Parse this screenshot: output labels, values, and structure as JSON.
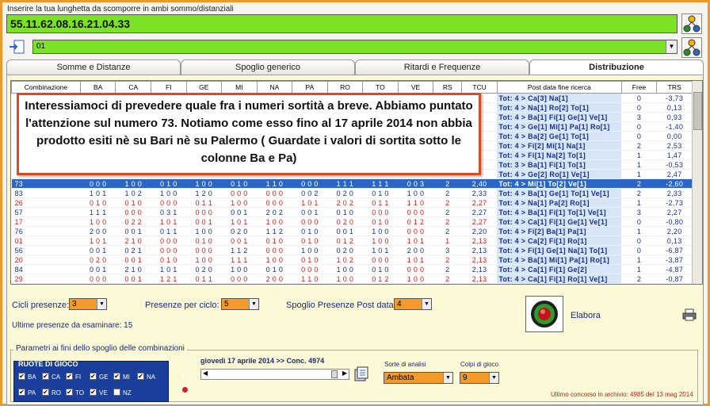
{
  "header": {
    "input_label": "Inserire la tua lunghetta da scomporre in ambi sommo/distanziali",
    "input_value": "55.11.62.08.16.21.04.33",
    "combo_value": "01"
  },
  "tabs": [
    "Somme e Distanze",
    "Spoglio generico",
    "Ritardi e Frequenze",
    "Distribuzione"
  ],
  "active_tab": "Distribuzione",
  "table": {
    "columns": [
      "Combinazione",
      "BA",
      "CA",
      "FI",
      "GE",
      "MI",
      "NA",
      "PA",
      "RO",
      "TO",
      "VE",
      "RS",
      "TCU",
      "Post data fine ricerca",
      "Free",
      "TRS"
    ],
    "rows": [
      {
        "comb": "",
        "cells": [
          "",
          "",
          "",
          "",
          "",
          "",
          "",
          "",
          "",
          "",
          "",
          ""
        ],
        "post": "Tot:  4 > Ca[3] Na[1]",
        "free": "0",
        "trs": "-3,73",
        "sel": false
      },
      {
        "comb": "",
        "cells": [
          "",
          "",
          "",
          "",
          "",
          "",
          "",
          "",
          "",
          "",
          "",
          ""
        ],
        "post": "Tot:  4 > Na[1] Ro[2] To[1]",
        "free": "0",
        "trs": "0,13",
        "sel": false
      },
      {
        "comb": "",
        "cells": [
          "",
          "",
          "",
          "",
          "",
          "",
          "",
          "",
          "",
          "",
          "",
          ""
        ],
        "post": "Tot:  4 > Ba[1] Fi[1] Ge[1] Ve[1]",
        "free": "3",
        "trs": "0,93",
        "sel": false
      },
      {
        "comb": "",
        "cells": [
          "",
          "",
          "",
          "",
          "",
          "",
          "",
          "",
          "",
          "",
          "",
          ""
        ],
        "post": "Tot:  4 > Ge[1] Mi[1] Pa[1] Ro[1]",
        "free": "0",
        "trs": "-1,40",
        "sel": false
      },
      {
        "comb": "",
        "cells": [
          "",
          "",
          "",
          "",
          "",
          "",
          "",
          "",
          "",
          "",
          "",
          ""
        ],
        "post": "Tot:  4 > Ba[2] Ge[1] To[1]",
        "free": "0",
        "trs": "0,00",
        "sel": false
      },
      {
        "comb": "",
        "cells": [
          "",
          "",
          "",
          "",
          "",
          "",
          "",
          "",
          "",
          "",
          "",
          ""
        ],
        "post": "Tot:  4 > Fi[2] Mi[1] Na[1]",
        "free": "2",
        "trs": "2,53",
        "sel": false
      },
      {
        "comb": "",
        "cells": [
          "",
          "",
          "",
          "",
          "",
          "",
          "",
          "",
          "",
          "",
          "",
          ""
        ],
        "post": "Tot:  4 > Fi[1] Na[2] To[1]",
        "free": "1",
        "trs": "1,47",
        "sel": false
      },
      {
        "comb": "",
        "cells": [
          "",
          "",
          "",
          "",
          "",
          "",
          "",
          "",
          "",
          "",
          "",
          ""
        ],
        "post": "Tot:  3 > Ba[1] Fi[1] To[1]",
        "free": "1",
        "trs": "-0,53",
        "sel": false
      },
      {
        "comb": "",
        "cells": [
          "",
          "",
          "",
          "",
          "",
          "",
          "",
          "",
          "",
          "",
          "",
          ""
        ],
        "post": "Tot:  4 > Ge[2] Ro[1] Ve[1]",
        "free": "1",
        "trs": "2,47",
        "sel": false
      },
      {
        "comb": "73",
        "cells": [
          "000",
          "100",
          "010",
          "100",
          "010",
          "110",
          "000",
          "111",
          "111",
          "003",
          "2",
          "2,40"
        ],
        "post": "Tot:  4 > Mi[1] To[2] Ve[1]",
        "free": "2",
        "trs": "-2,60",
        "sel": true
      },
      {
        "comb": "83",
        "cells": [
          "101",
          "102",
          "100",
          "120",
          "000",
          "000",
          "002",
          "020",
          "010",
          "100",
          "2",
          "2,33"
        ],
        "post": "Tot:  4 > Ba[1] Ge[1] To[1] Ve[1]",
        "free": "2",
        "trs": "2,33",
        "sel": false
      },
      {
        "comb": "26",
        "cells": [
          "010",
          "010",
          "000",
          "011",
          "100",
          "000",
          "101",
          "202",
          "011",
          "110",
          "2",
          "2,27"
        ],
        "post": "Tot:  4 > Na[1] Pa[2] Ro[1]",
        "free": "1",
        "trs": "-2,73",
        "sel": false
      },
      {
        "comb": "57",
        "cells": [
          "111",
          "000",
          "031",
          "000",
          "001",
          "202",
          "001",
          "010",
          "000",
          "000",
          "2",
          "2,27"
        ],
        "post": "Tot:  4 > Ba[1] Fi[1] To[1] Ve[1]",
        "free": "3",
        "trs": "2,27",
        "sel": false
      },
      {
        "comb": "17",
        "cells": [
          "100",
          "022",
          "101",
          "001",
          "101",
          "100",
          "000",
          "020",
          "010",
          "012",
          "2",
          "2,27"
        ],
        "post": "Tot:  4 > Ca[1] Fi[1] Ge[1] Ve[1]",
        "free": "0",
        "trs": "-0,80",
        "sel": false
      },
      {
        "comb": "76",
        "cells": [
          "200",
          "001",
          "011",
          "100",
          "020",
          "112",
          "010",
          "001",
          "100",
          "000",
          "2",
          "2,20"
        ],
        "post": "Tot:  4 > Fi[2] Ba[1] Pa[1]",
        "free": "1",
        "trs": "2,20",
        "sel": false
      },
      {
        "comb": "01",
        "cells": [
          "101",
          "210",
          "000",
          "010",
          "001",
          "010",
          "010",
          "012",
          "100",
          "101",
          "1",
          "2,13"
        ],
        "post": "Tot:  4 > Ca[2] Fi[1] Ro[1]",
        "free": "0",
        "trs": "0,13",
        "sel": false
      },
      {
        "comb": "56",
        "cells": [
          "001",
          "021",
          "000",
          "000",
          "112",
          "000",
          "100",
          "020",
          "101",
          "200",
          "3",
          "2,13"
        ],
        "post": "Tot:  4 > Fi[1] Ge[1] Na[1] To[1]",
        "free": "0",
        "trs": "-6,87",
        "sel": false
      },
      {
        "comb": "20",
        "cells": [
          "020",
          "001",
          "010",
          "100",
          "111",
          "100",
          "010",
          "102",
          "000",
          "101",
          "2",
          "2,13"
        ],
        "post": "Tot:  4 > Ba[1] Mi[1] Pa[1] Ro[1]",
        "free": "1",
        "trs": "-3,87",
        "sel": false
      },
      {
        "comb": "84",
        "cells": [
          "001",
          "210",
          "101",
          "020",
          "100",
          "010",
          "000",
          "100",
          "010",
          "000",
          "2",
          "2,13"
        ],
        "post": "Tot:  4 > Ca[1] Fi[1] Ge[2]",
        "free": "1",
        "trs": "-4,87",
        "sel": false
      },
      {
        "comb": "29",
        "cells": [
          "000",
          "001",
          "121",
          "011",
          "000",
          "200",
          "110",
          "100",
          "012",
          "100",
          "2",
          "2,13"
        ],
        "post": "Tot:  4 > Ca[1] Fi[1] Ro[1] Ve[1]",
        "free": "2",
        "trs": "-0,87",
        "sel": false
      }
    ]
  },
  "overlay_text": "Interessiamoci di prevedere quale fra i numeri sortità a breve. Abbiamo puntato l'attenzione sul numero 73. Notiamo come esso fino al 17 aprile 2014 non abbia prodotto esiti nè su Bari nè su Palermo ( Guardate i valori di sortita sotto le colonne Ba e Pa)",
  "controls": {
    "cicli_label": "Cicli presenze:",
    "cicli_value": "3",
    "presenze_label": "Presenze per ciclo:",
    "presenze_value": "5",
    "spoglio_label": "Spoglio Presenze Post data:",
    "spoglio_value": "4",
    "ultime_label": "Ultime presenze da esaminare: 15",
    "elabora_label": "Elabora"
  },
  "params": {
    "legend": "Parametri ai fini dello spoglio delle combinazioni",
    "ruote_title": "RUOTE DI GIOCO",
    "ruote_row1": [
      "BA",
      "CA",
      "FI",
      "GE",
      "MI",
      "NA"
    ],
    "ruote_row2": [
      "PA",
      "RO",
      "TO",
      "VE",
      "NZ"
    ],
    "date_label": "giovedì 17 aprile 2014 >> Conc. 4974",
    "sorte_label": "Sorte di analisi",
    "sorte_value": "Ambata",
    "colpi_label": "Colpi di gioco",
    "colpi_value": "9",
    "archive": "Ultimo concorso in archivio: 4985 del 13 mag 2014"
  },
  "colors": {
    "accent_green": "#7be224",
    "border_orange": "#e99a2a",
    "select_orange": "#f29a2a",
    "row_select": "#2b66c4",
    "ruote_blue": "#1a3e9c"
  }
}
